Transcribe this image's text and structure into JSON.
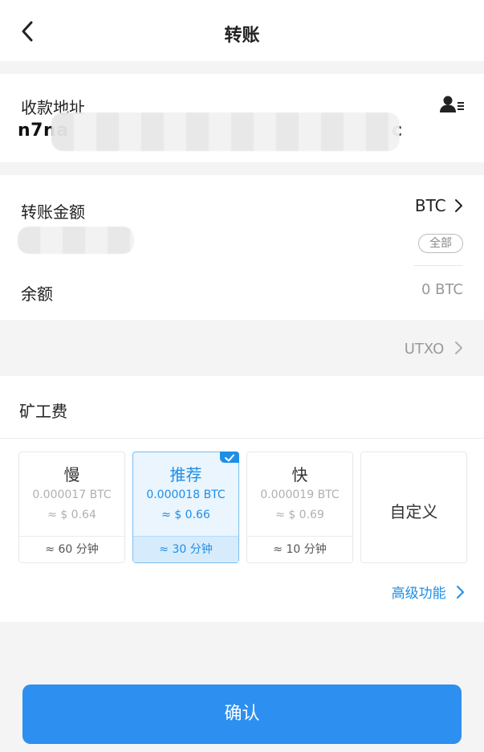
{
  "header": {
    "title": "转账"
  },
  "address": {
    "label": "收款地址",
    "value_start": "n7na",
    "value_end": "c"
  },
  "amount": {
    "label": "转账金额",
    "currency": "BTC",
    "all_label": "全部"
  },
  "balance": {
    "label": "余额",
    "value": "0 BTC"
  },
  "utxo": {
    "label": "UTXO"
  },
  "fee": {
    "label": "矿工费",
    "options": [
      {
        "speed": "慢",
        "btc": "0.000017 BTC",
        "usd": "≈ $ 0.64",
        "time": "≈ 60 分钟",
        "selected": false
      },
      {
        "speed": "推荐",
        "btc": "0.000018 BTC",
        "usd": "≈ $ 0.66",
        "time": "≈ 30 分钟",
        "selected": true
      },
      {
        "speed": "快",
        "btc": "0.000019 BTC",
        "usd": "≈ $ 0.69",
        "time": "≈ 10 分钟",
        "selected": false
      }
    ],
    "custom_label": "自定义",
    "advanced_label": "高级功能"
  },
  "confirm": {
    "label": "确认"
  },
  "colors": {
    "accent": "#2d8ff0",
    "selected_bg": "#eaf5fd"
  },
  "icons": {
    "back": "chevron-left-icon",
    "contact": "contact-list-icon",
    "check": "check-icon"
  }
}
